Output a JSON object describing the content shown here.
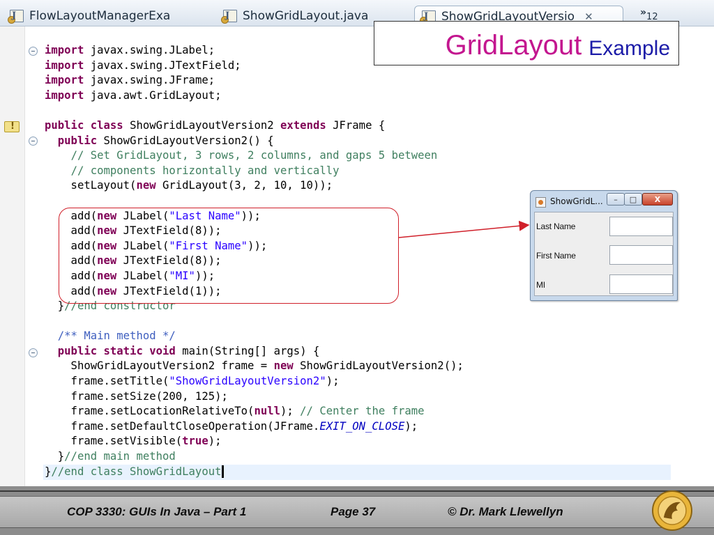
{
  "tabs": [
    {
      "label": "FlowLayoutManagerExa",
      "active": false
    },
    {
      "label": "ShowGridLayout.java",
      "active": false
    },
    {
      "label": "ShowGridLayoutVersio",
      "active": true,
      "close": "✕"
    }
  ],
  "overflow": {
    "chevron": "»",
    "count": "12"
  },
  "title": {
    "main": "GridLayout",
    "sub": "Example"
  },
  "code_lines": [
    "import javax.swing.JLabel;",
    "import javax.swing.JTextField;",
    "import javax.swing.JFrame;",
    "import java.awt.GridLayout;",
    "",
    "public class ShowGridLayoutVersion2 extends JFrame {",
    "  public ShowGridLayoutVersion2() {",
    "    // Set GridLayout, 3 rows, 2 columns, and gaps 5 between",
    "    // components horizontally and vertically",
    "    setLayout(new GridLayout(3, 2, 10, 10));",
    "",
    "    add(new JLabel(\"Last Name\"));",
    "    add(new JTextField(8));",
    "    add(new JLabel(\"First Name\"));",
    "    add(new JTextField(8));",
    "    add(new JLabel(\"MI\"));",
    "    add(new JTextField(1));",
    "  }//end constructor",
    "",
    "  /** Main method */",
    "  public static void main(String[] args) {",
    "    ShowGridLayoutVersion2 frame = new ShowGridLayoutVersion2();",
    "    frame.setTitle(\"ShowGridLayoutVersion2\");",
    "    frame.setSize(200, 125);",
    "    frame.setLocationRelativeTo(null); // Center the frame",
    "    frame.setDefaultCloseOperation(JFrame.EXIT_ON_CLOSE);",
    "    frame.setVisible(true);",
    "  }//end main method",
    "}//end class ShowGridLayout"
  ],
  "window": {
    "title": "ShowGridL...",
    "buttons": {
      "minimize": "–",
      "maximize": "□",
      "close": "X"
    },
    "rows": [
      {
        "label": "Last Name",
        "value": ""
      },
      {
        "label": "First Name",
        "value": ""
      },
      {
        "label": "MI",
        "value": ""
      }
    ]
  },
  "footer": {
    "course": "COP 3330:  GUIs In Java – Part 1",
    "page": "Page 37",
    "author": "© Dr. Mark Llewellyn"
  },
  "colors": {
    "title_main": "#c3168f",
    "title_sub": "#1c1ca8",
    "keyword": "#7f0055",
    "string": "#2a00ff",
    "comment": "#3f7f5f",
    "highlight": "#d0202a"
  }
}
